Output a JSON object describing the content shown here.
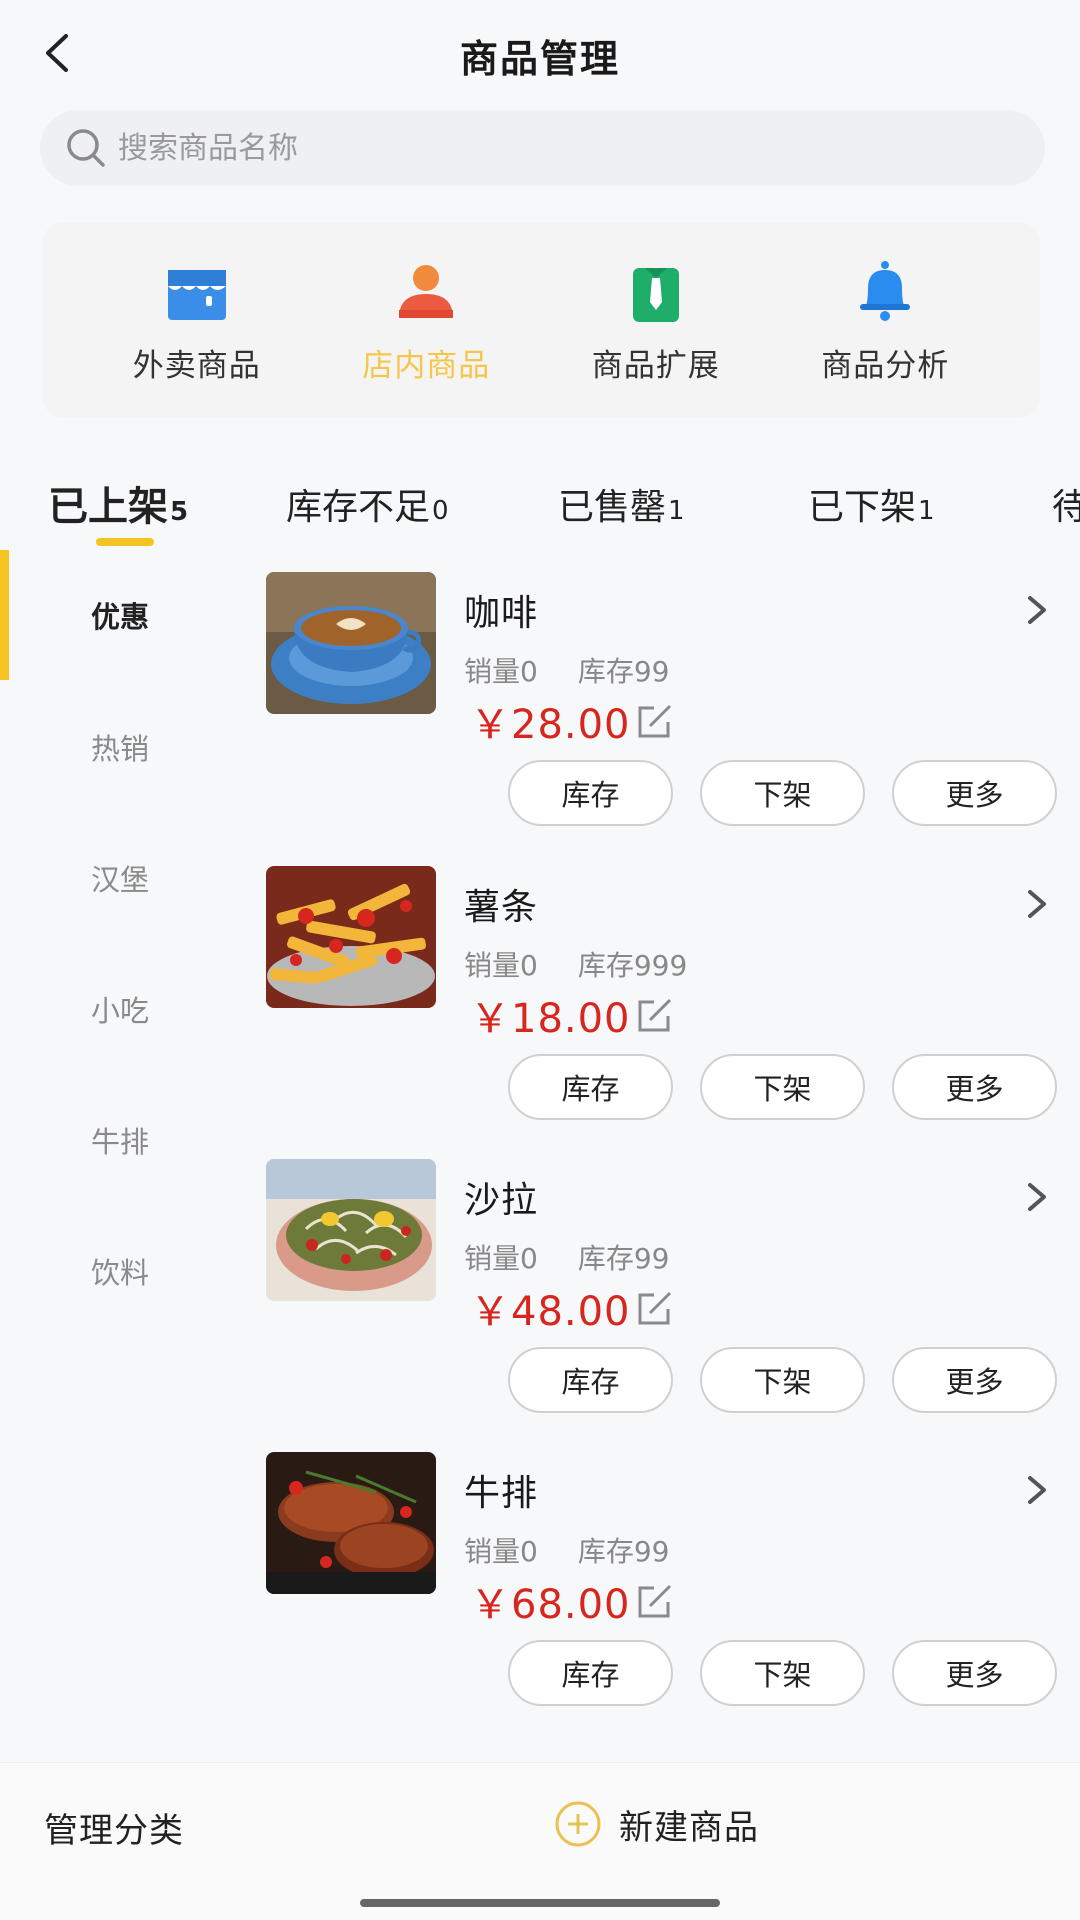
{
  "header": {
    "title": "商品管理"
  },
  "search": {
    "placeholder": "搜索商品名称"
  },
  "categories": [
    {
      "label": "外卖商品",
      "icon": "storefront-icon",
      "active": false
    },
    {
      "label": "店内商品",
      "icon": "person-icon",
      "active": true
    },
    {
      "label": "商品扩展",
      "icon": "shirt-tie-icon",
      "active": false
    },
    {
      "label": "商品分析",
      "icon": "bell-icon",
      "active": false
    }
  ],
  "tabs": [
    {
      "label": "已上架",
      "count": "5",
      "active": true
    },
    {
      "label": "库存不足",
      "count": "0",
      "active": false
    },
    {
      "label": "已售罄",
      "count": "1",
      "active": false
    },
    {
      "label": "已下架",
      "count": "1",
      "active": false
    },
    {
      "label": "待",
      "count": "",
      "active": false
    }
  ],
  "side_categories": [
    {
      "label": "优惠",
      "active": true
    },
    {
      "label": "热销",
      "active": false
    },
    {
      "label": "汉堡",
      "active": false
    },
    {
      "label": "小吃",
      "active": false
    },
    {
      "label": "牛排",
      "active": false
    },
    {
      "label": "饮料",
      "active": false
    }
  ],
  "products": [
    {
      "name": "咖啡",
      "sales": "销量0",
      "stock": "库存99",
      "price": "￥28.00",
      "image": "coffee-image"
    },
    {
      "name": "薯条",
      "sales": "销量0",
      "stock": "库存999",
      "price": "￥18.00",
      "image": "fries-image"
    },
    {
      "name": "沙拉",
      "sales": "销量0",
      "stock": "库存99",
      "price": "￥48.00",
      "image": "salad-image"
    },
    {
      "name": "牛排",
      "sales": "销量0",
      "stock": "库存99",
      "price": "￥68.00",
      "image": "steak-image"
    }
  ],
  "product_actions": {
    "stock": "库存",
    "unlist": "下架",
    "more": "更多"
  },
  "footer": {
    "manage_label": "管理分类",
    "new_label": "新建商品"
  },
  "colors": {
    "accent": "#f5c322",
    "price": "#d7261e",
    "active_category": "#f4c74a"
  }
}
